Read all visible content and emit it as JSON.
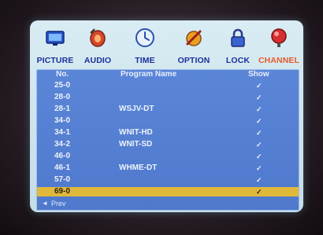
{
  "tabs": [
    {
      "label": "PICTURE",
      "icon": "picture-icon"
    },
    {
      "label": "AUDIO",
      "icon": "audio-icon"
    },
    {
      "label": "TIME",
      "icon": "clock-icon"
    },
    {
      "label": "OPTION",
      "icon": "option-icon"
    },
    {
      "label": "LOCK",
      "icon": "lock-icon"
    },
    {
      "label": "CHANNEL",
      "icon": "channel-icon",
      "active": true
    }
  ],
  "table": {
    "headers": {
      "no": "No.",
      "name": "Program Name",
      "show": "Show"
    },
    "rows": [
      {
        "no": "25-0",
        "name": "",
        "show": "✓"
      },
      {
        "no": "28-0",
        "name": "",
        "show": "✓"
      },
      {
        "no": "28-1",
        "name": "WSJV-DT",
        "show": "✓"
      },
      {
        "no": "34-0",
        "name": "",
        "show": "✓"
      },
      {
        "no": "34-1",
        "name": "WNIT-HD",
        "show": "✓"
      },
      {
        "no": "34-2",
        "name": "WNIT-SD",
        "show": "✓"
      },
      {
        "no": "46-0",
        "name": "",
        "show": "✓"
      },
      {
        "no": "46-1",
        "name": "WHME-DT",
        "show": "✓"
      },
      {
        "no": "57-0",
        "name": "",
        "show": "✓"
      },
      {
        "no": "69-0",
        "name": "",
        "show": "✓",
        "selected": true
      }
    ]
  },
  "footer": {
    "prev_label": "Prev",
    "prev_icon": "left-arrow-icon"
  },
  "colors": {
    "tab_text": "#1b2f9a",
    "tab_active": "#e65a2a",
    "panel": "#5580d2",
    "selection": "#e0b93a"
  }
}
